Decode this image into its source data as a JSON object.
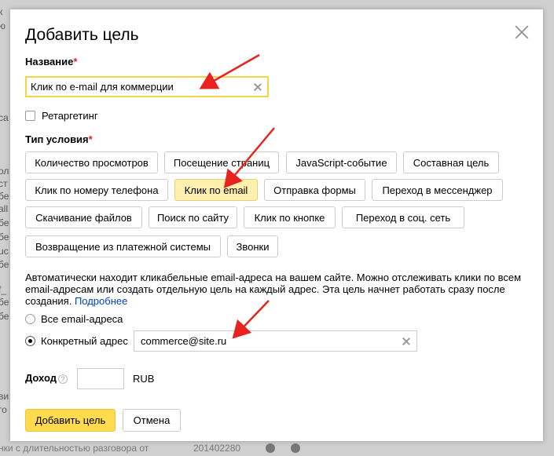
{
  "background": {
    "fragments": [
      "к",
      "ю",
      "са",
      "ол",
      "ст",
      "бе",
      "all",
      "бе",
      "бе",
      "uc",
      "бе",
      "f_",
      "бе",
      "бе",
      "ви",
      "го"
    ],
    "footer_text": "нки с длительностью разговора от",
    "footer_number": "201402280"
  },
  "modal": {
    "title": "Добавить цель",
    "name_label": "Название",
    "required_mark": "*",
    "name_value": "Клик по e-mail для коммерции",
    "retargeting_label": "Ретаргетинг",
    "condition_label": "Тип условия",
    "condition_types": [
      "Количество просмотров",
      "Посещение страниц",
      "JavaScript-событие",
      "Составная цель",
      "Клик по номеру телефона",
      "Клик по email",
      "Отправка формы",
      "Переход в мессенджер",
      "Скачивание файлов",
      "Поиск по сайту",
      "Клик по кнопке",
      "Переход в соц. сеть",
      "Возвращение из платежной системы",
      "Звонки"
    ],
    "selected_condition": "Клик по email",
    "description": "Автоматически находит кликабельные email-адреса на вашем сайте. Можно отслеживать клики по всем email-адресам или создать отдельную цель на каждый адрес. Эта цель начнет работать сразу после создания.",
    "more_link": "Подробнее",
    "radio_all": "Все email-адреса",
    "radio_specific": "Конкретный адрес",
    "specific_address_value": "commerce@site.ru",
    "income_label": "Доход",
    "help_glyph": "?",
    "income_value": "",
    "currency": "RUB",
    "submit_label": "Добавить цель",
    "cancel_label": "Отмена"
  },
  "colors": {
    "accent_yellow": "#ffdb4d",
    "selected_option": "#fff0b0",
    "input_focus_border": "#f4d645",
    "required_red": "#e41e1e",
    "link_blue": "#0044bb",
    "annotation_arrow": "#e8231f"
  }
}
